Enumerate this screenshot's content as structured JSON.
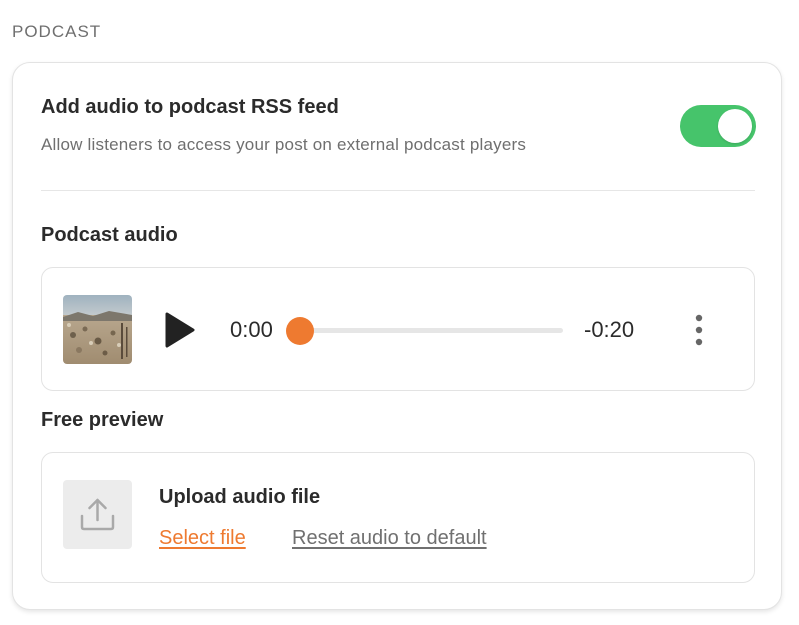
{
  "section": {
    "label": "PODCAST"
  },
  "rss": {
    "title": "Add audio to podcast RSS feed",
    "description": "Allow listeners to access your post on external podcast players",
    "enabled": true
  },
  "podcast_audio": {
    "heading": "Podcast audio",
    "player": {
      "current_time": "0:00",
      "remaining_time": "-0:20",
      "progress": 0.0
    }
  },
  "free_preview": {
    "heading": "Free preview",
    "upload_title": "Upload audio file",
    "select_label": "Select file",
    "reset_label": "Reset audio to default"
  },
  "colors": {
    "accent": "#ee7a30",
    "toggle_on": "#46c46b"
  },
  "icons": {
    "play": "play-icon",
    "more": "more-vertical-icon",
    "upload": "upload-icon"
  }
}
